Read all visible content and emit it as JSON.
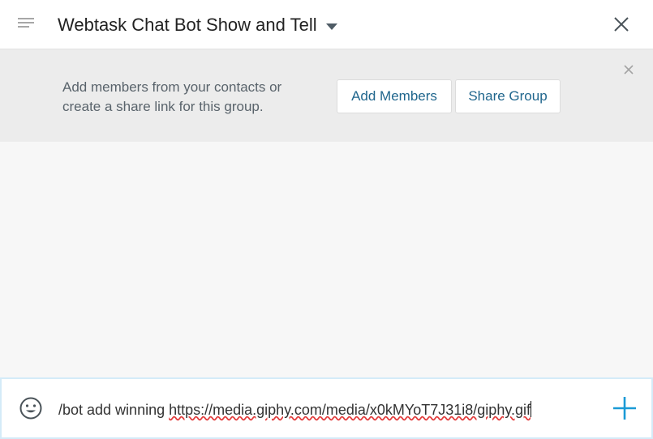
{
  "header": {
    "title": "Webtask Chat Bot Show and Tell",
    "logo_icon": "group-avatar-icon",
    "caret_icon": "chevron-down-icon",
    "close_icon": "close-icon"
  },
  "banner": {
    "message": "Add members from your contacts or create a share link for this group.",
    "add_members_label": "Add Members",
    "share_group_label": "Share Group",
    "dismiss_icon": "close-icon"
  },
  "composer": {
    "emoji_icon": "smiley-icon",
    "input_text_prefix": "/bot add winning ",
    "input_text_link": "https://media.giphy.com/media/x0kMYoT7J31i8/giphy.gif",
    "add_icon": "plus-icon"
  },
  "colors": {
    "accent": "#1a9ad6",
    "button_text": "#20668d",
    "banner_bg": "#ececec",
    "body_bg": "#f7f7f7"
  }
}
